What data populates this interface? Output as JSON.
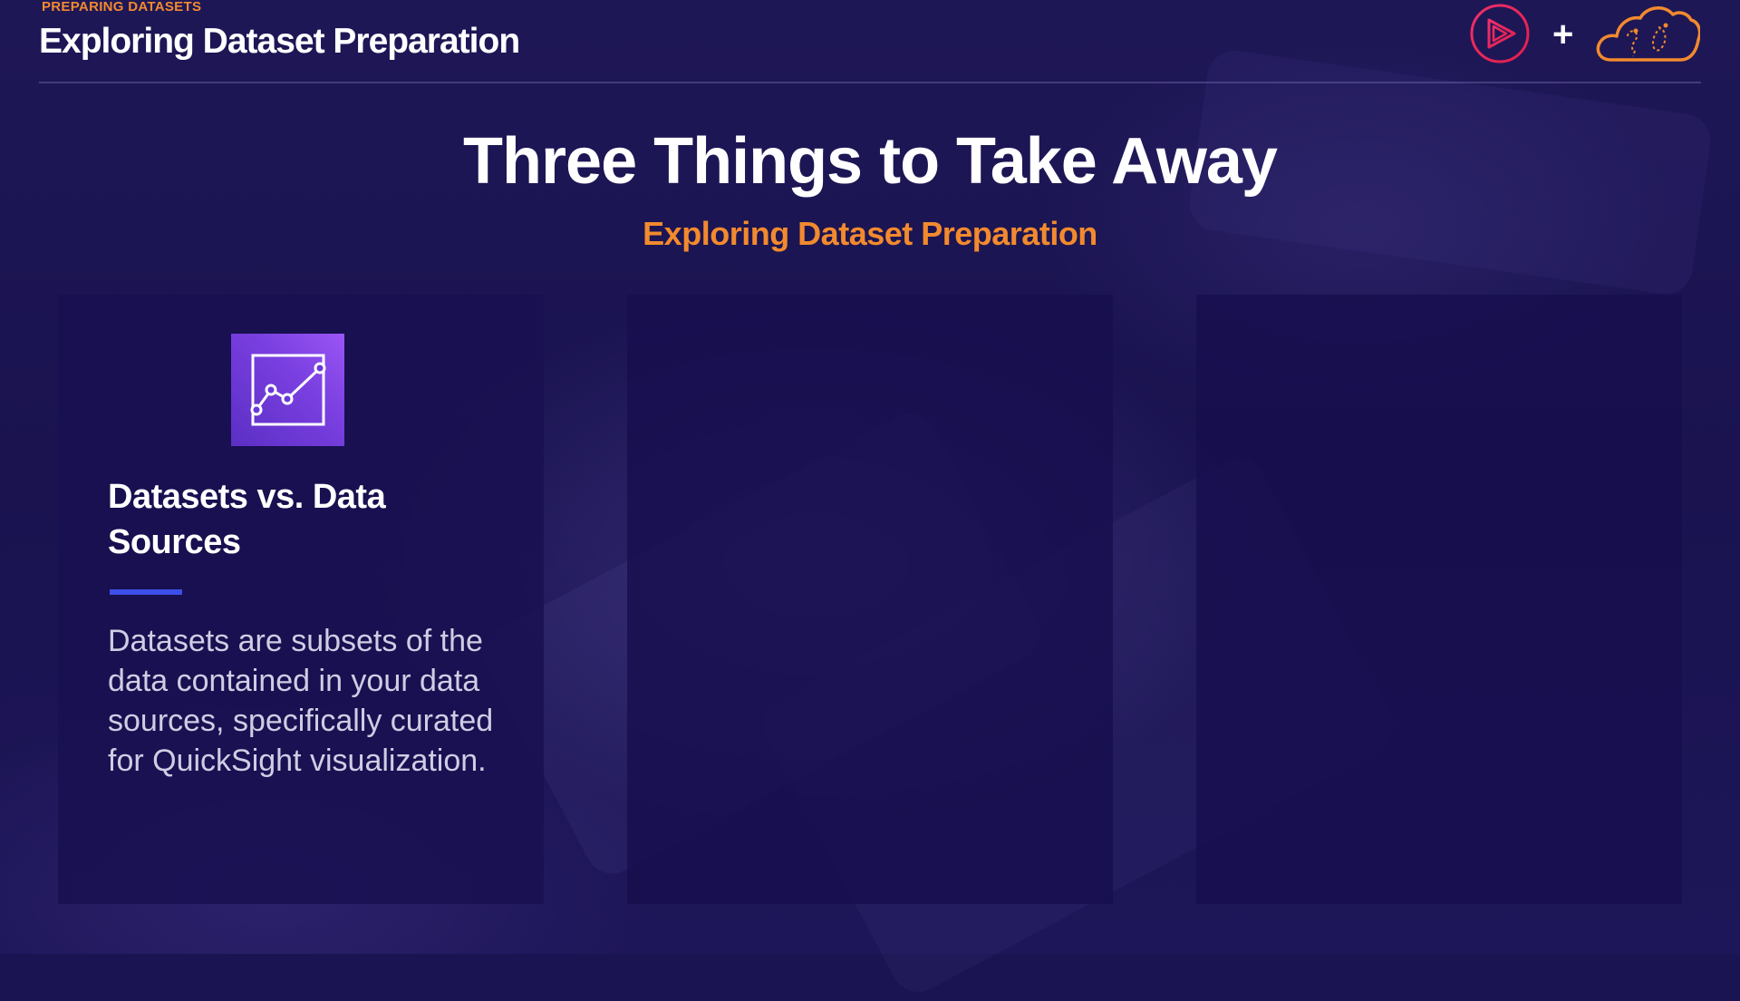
{
  "header": {
    "eyebrow": "PREPARING DATASETS",
    "title": "Exploring Dataset Preparation",
    "plus_sign": "+"
  },
  "logos": {
    "play_icon": "pluralsight-play-icon",
    "cloud_icon": "cloud-logo-icon"
  },
  "slide": {
    "title": "Three Things to Take Away",
    "subtitle": "Exploring Dataset Preparation"
  },
  "cards": [
    {
      "icon": "quicksight-dataset-chart-icon",
      "heading": "Datasets vs. Data Sources",
      "body": "Datasets are subsets of the data contained in your data sources, specifically curated for QuickSight visualization."
    },
    {},
    {}
  ],
  "colors": {
    "accent_orange": "#f28a2e",
    "accent_blue": "#3e4ee8",
    "icon_purple": "#7a3fe0",
    "logo_pink": "#e8245a",
    "background": "#1b1452"
  }
}
